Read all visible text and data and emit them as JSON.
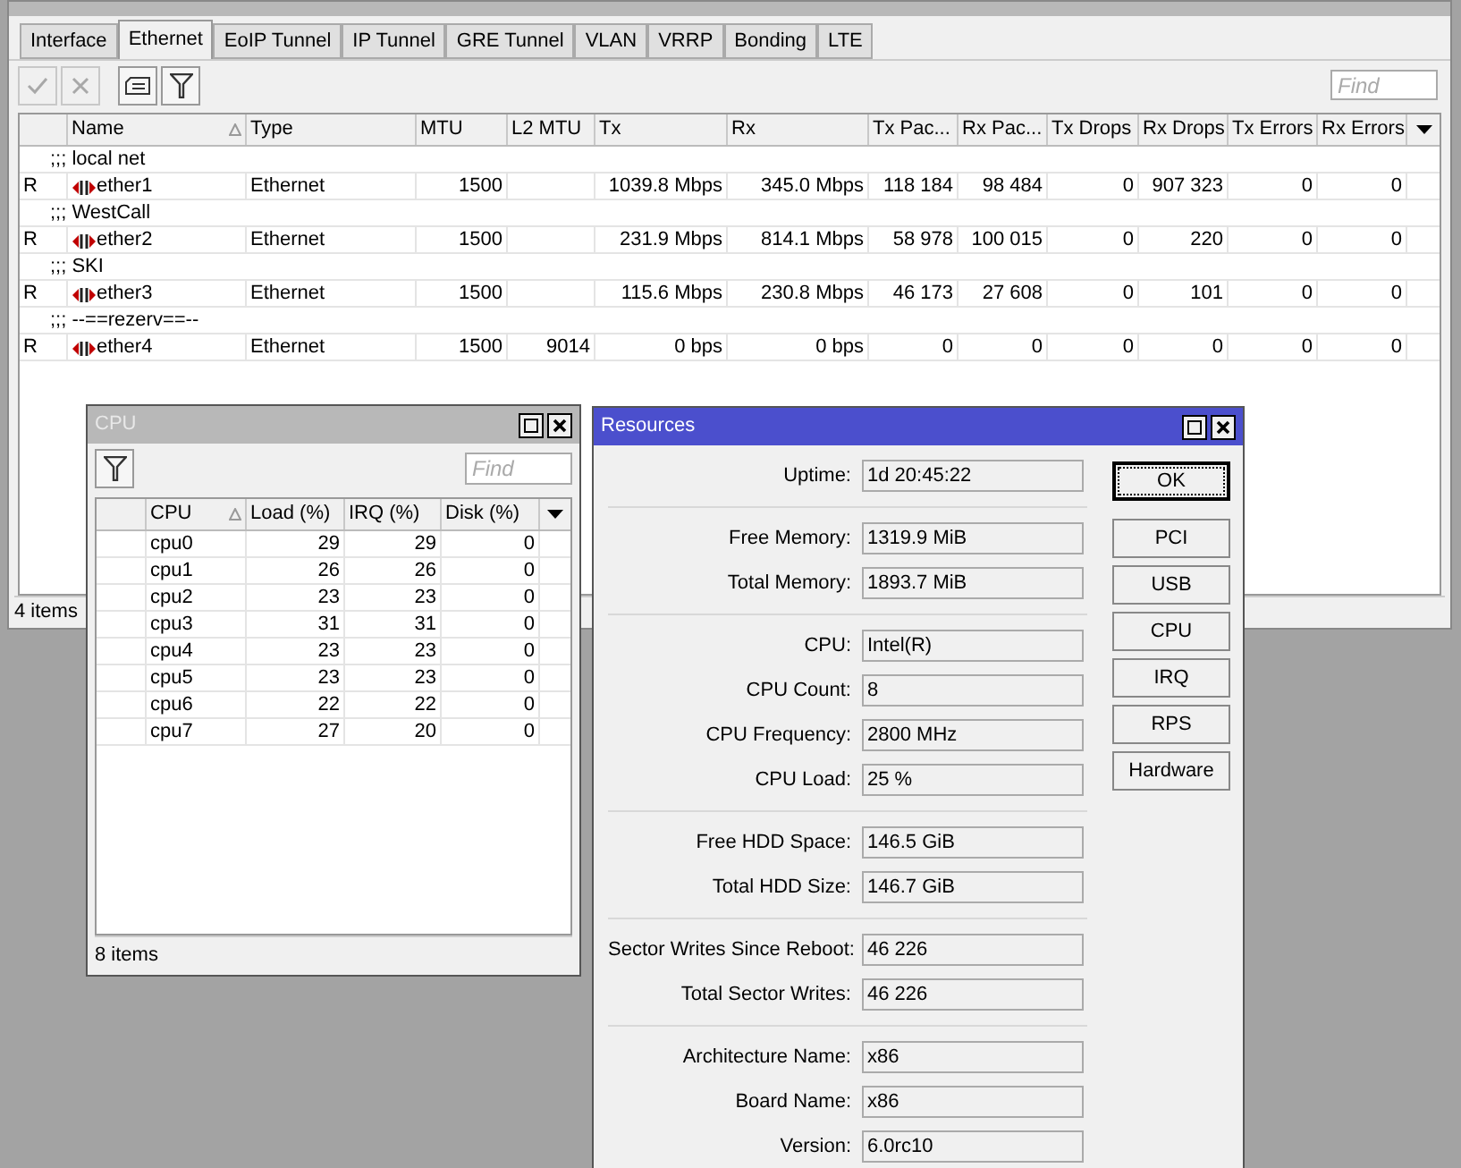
{
  "interface_list": {
    "tabs": [
      {
        "label": "Interface",
        "selected": false
      },
      {
        "label": "Ethernet",
        "selected": true
      },
      {
        "label": "EoIP Tunnel",
        "selected": false
      },
      {
        "label": "IP Tunnel",
        "selected": false
      },
      {
        "label": "GRE Tunnel",
        "selected": false
      },
      {
        "label": "VLAN",
        "selected": false
      },
      {
        "label": "VRRP",
        "selected": false
      },
      {
        "label": "Bonding",
        "selected": false
      },
      {
        "label": "LTE",
        "selected": false
      }
    ],
    "toolbar": [
      {
        "kind": "enable",
        "disabled": true
      },
      {
        "kind": "disable",
        "disabled": true
      },
      {
        "kind": "comment",
        "disabled": false
      },
      {
        "kind": "filter",
        "disabled": false
      }
    ],
    "find": {
      "placeholder": "Find"
    },
    "columns": [
      {
        "label": "Name",
        "sorted": true
      },
      {
        "label": "Type",
        "sorted": false
      },
      {
        "label": "MTU",
        "sorted": false
      },
      {
        "label": "L2 MTU",
        "sorted": false
      },
      {
        "label": "Tx",
        "sorted": false
      },
      {
        "label": "Rx",
        "sorted": false
      },
      {
        "label": "Tx Pac...",
        "sorted": false
      },
      {
        "label": "Rx Pac...",
        "sorted": false
      },
      {
        "label": "Tx Drops",
        "sorted": false
      },
      {
        "label": "Rx Drops",
        "sorted": false
      },
      {
        "label": "Tx Errors",
        "sorted": false
      },
      {
        "label": "Rx Errors",
        "sorted": false
      }
    ],
    "rows": [
      {
        "kind": "comment",
        "text": ";;; local net"
      },
      {
        "kind": "interface",
        "flag": "R",
        "cells": [
          "ether1",
          "Ethernet",
          "1500",
          "",
          "1039.8 Mbps",
          "345.0 Mbps",
          "118 184",
          "98 484",
          "0",
          "907 323",
          "0",
          "0"
        ]
      },
      {
        "kind": "comment",
        "text": ";;; WestCall"
      },
      {
        "kind": "interface",
        "flag": "R",
        "cells": [
          "ether2",
          "Ethernet",
          "1500",
          "",
          "231.9 Mbps",
          "814.1 Mbps",
          "58 978",
          "100 015",
          "0",
          "220",
          "0",
          "0"
        ]
      },
      {
        "kind": "comment",
        "text": ";;; SKI"
      },
      {
        "kind": "interface",
        "flag": "R",
        "cells": [
          "ether3",
          "Ethernet",
          "1500",
          "",
          "115.6 Mbps",
          "230.8 Mbps",
          "46 173",
          "27 608",
          "0",
          "101",
          "0",
          "0"
        ]
      },
      {
        "kind": "comment",
        "text": ";;; --==rezerv==--"
      },
      {
        "kind": "interface",
        "flag": "R",
        "cells": [
          "ether4",
          "Ethernet",
          "1500",
          "9014",
          "0 bps",
          "0 bps",
          "0",
          "0",
          "0",
          "0",
          "0",
          "0"
        ]
      }
    ],
    "status": "4 items"
  },
  "cpu_window": {
    "title": "CPU",
    "active": false,
    "find": {
      "placeholder": "Find"
    },
    "columns": [
      {
        "label": "CPU",
        "sorted": true
      },
      {
        "label": "Load (%)",
        "sorted": false
      },
      {
        "label": "IRQ (%)",
        "sorted": false
      },
      {
        "label": "Disk (%)",
        "sorted": false
      }
    ],
    "rows": [
      [
        "cpu0",
        "29",
        "29",
        "0"
      ],
      [
        "cpu1",
        "26",
        "26",
        "0"
      ],
      [
        "cpu2",
        "23",
        "23",
        "0"
      ],
      [
        "cpu3",
        "31",
        "31",
        "0"
      ],
      [
        "cpu4",
        "23",
        "23",
        "0"
      ],
      [
        "cpu5",
        "23",
        "23",
        "0"
      ],
      [
        "cpu6",
        "22",
        "22",
        "0"
      ],
      [
        "cpu7",
        "27",
        "20",
        "0"
      ]
    ],
    "status": "8 items"
  },
  "resources": {
    "title": "Resources",
    "active": true,
    "groups": [
      [
        {
          "label": "Uptime:",
          "value": "1d 20:45:22"
        }
      ],
      [
        {
          "label": "Free Memory:",
          "value": "1319.9 MiB"
        },
        {
          "label": "Total Memory:",
          "value": "1893.7 MiB"
        }
      ],
      [
        {
          "label": "CPU:",
          "value": "Intel(R)"
        },
        {
          "label": "CPU Count:",
          "value": "8"
        },
        {
          "label": "CPU Frequency:",
          "value": "2800 MHz"
        },
        {
          "label": "CPU Load:",
          "value": "25 %"
        }
      ],
      [
        {
          "label": "Free HDD Space:",
          "value": "146.5 GiB"
        },
        {
          "label": "Total HDD Size:",
          "value": "146.7 GiB"
        }
      ],
      [
        {
          "label": "Sector Writes Since Reboot:",
          "value": "46 226"
        },
        {
          "label": "Total Sector Writes:",
          "value": "46 226"
        }
      ],
      [
        {
          "label": "Architecture Name:",
          "value": "x86"
        },
        {
          "label": "Board Name:",
          "value": "x86"
        },
        {
          "label": "Version:",
          "value": "6.0rc10"
        }
      ]
    ],
    "buttons": [
      {
        "label": "OK",
        "focused": true
      },
      {
        "label": "PCI",
        "focused": false
      },
      {
        "label": "USB",
        "focused": false
      },
      {
        "label": "CPU",
        "focused": false
      },
      {
        "label": "IRQ",
        "focused": false
      },
      {
        "label": "RPS",
        "focused": false
      },
      {
        "label": "Hardware",
        "focused": false
      }
    ]
  }
}
